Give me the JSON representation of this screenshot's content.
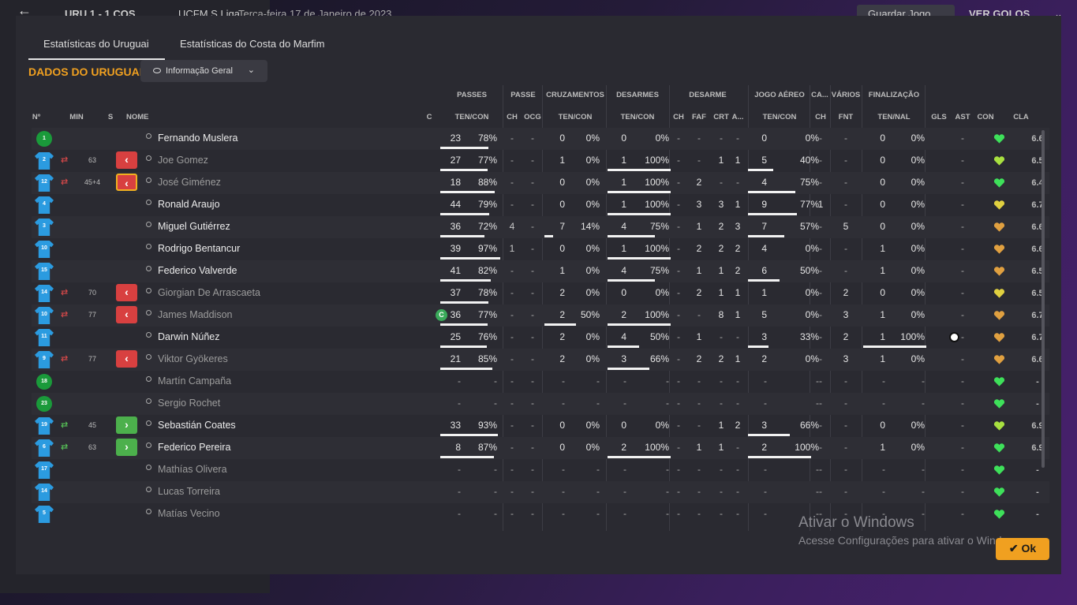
{
  "topbar": {
    "score": "URU 1 - 1 COS",
    "competition": "UCFM S.Liga",
    "date": "Terça-feira 17 de Janeiro de 2023",
    "save_label": "Guardar Jogo",
    "goals_label": "VER GOLOS"
  },
  "tabs": [
    "Estatísticas do Uruguai",
    "Estatísticas do Costa do Marfim"
  ],
  "section_title": "DADOS DO URUGUAI",
  "dropdown_label": "Informação Geral",
  "group_headers": [
    "PASSES",
    "PASSE",
    "CRUZAMENTOS",
    "DESARMES",
    "DESARME",
    "JOGO AÉREO",
    "CA...",
    "VÁRIOS",
    "FINALIZAÇÃO"
  ],
  "columns": [
    "Nº",
    "MIN",
    "S",
    "NOME",
    "C",
    "TEN/CON",
    "CH",
    "OCG",
    "TEN/CON",
    "TEN/CON",
    "CH",
    "FAF",
    "CRT",
    "A...",
    "TEN/CON",
    "CH",
    "FNT",
    "TEN/NAL",
    "GLS",
    "AST",
    "CON",
    "CLA"
  ],
  "heart_colors": {
    "green": "#3ee05a",
    "lime": "#a8e040",
    "yellow": "#e0d040",
    "orange": "#e0a040"
  },
  "players": [
    {
      "num": "1",
      "gk": true,
      "min": "",
      "sub": "",
      "s": "",
      "name": "Fernando Muslera",
      "dim": false,
      "cap": false,
      "pass": [
        "23",
        "78%"
      ],
      "pbar": 0.78,
      "ch": "-",
      "ocg": "-",
      "cross": [
        "0",
        "0%"
      ],
      "cbar": 0,
      "tck": [
        "0",
        "0%"
      ],
      "tbar": 0,
      "dch": "-",
      "faf": "-",
      "crt": "-",
      "a": "-",
      "air": [
        "0",
        "0%"
      ],
      "abar": 0,
      "ca": "-",
      "fnt": "-",
      "shot": [
        "0",
        "0%"
      ],
      "sbar": 0,
      "gls": "",
      "ast": "-",
      "heart": "green",
      "cla": "6.6"
    },
    {
      "num": "2",
      "gk": false,
      "min": "63",
      "sub": "out",
      "s": "red",
      "name": "Joe Gomez",
      "dim": true,
      "cap": false,
      "pass": [
        "27",
        "77%"
      ],
      "pbar": 0.77,
      "ch": "-",
      "ocg": "-",
      "cross": [
        "1",
        "0%"
      ],
      "cbar": 0,
      "tck": [
        "1",
        "100%"
      ],
      "tbar": 1,
      "dch": "-",
      "faf": "-",
      "crt": "1",
      "a": "1",
      "air": [
        "5",
        "40%"
      ],
      "abar": 0.4,
      "ca": "-",
      "fnt": "-",
      "shot": [
        "0",
        "0%"
      ],
      "sbar": 0,
      "gls": "",
      "ast": "-",
      "heart": "lime",
      "cla": "6.5"
    },
    {
      "num": "12",
      "gk": false,
      "min": "45+4",
      "sub": "out",
      "s": "redsel",
      "name": "José Giménez",
      "dim": true,
      "cap": false,
      "pass": [
        "18",
        "88%"
      ],
      "pbar": 0.88,
      "ch": "-",
      "ocg": "-",
      "cross": [
        "0",
        "0%"
      ],
      "cbar": 0,
      "tck": [
        "1",
        "100%"
      ],
      "tbar": 1,
      "dch": "-",
      "faf": "2",
      "crt": "-",
      "a": "-",
      "air": [
        "4",
        "75%"
      ],
      "abar": 0.75,
      "ca": "-",
      "fnt": "-",
      "shot": [
        "0",
        "0%"
      ],
      "sbar": 0,
      "gls": "",
      "ast": "-",
      "heart": "green",
      "cla": "6.4"
    },
    {
      "num": "4",
      "gk": false,
      "min": "",
      "sub": "",
      "s": "",
      "name": "Ronald Araujo",
      "dim": false,
      "cap": false,
      "pass": [
        "44",
        "79%"
      ],
      "pbar": 0.79,
      "ch": "-",
      "ocg": "-",
      "cross": [
        "0",
        "0%"
      ],
      "cbar": 0,
      "tck": [
        "1",
        "100%"
      ],
      "tbar": 1,
      "dch": "-",
      "faf": "3",
      "crt": "3",
      "a": "1",
      "air": [
        "9",
        "77%"
      ],
      "abar": 0.77,
      "ca": "1",
      "fnt": "-",
      "shot": [
        "0",
        "0%"
      ],
      "sbar": 0,
      "gls": "",
      "ast": "-",
      "heart": "yellow",
      "cla": "6.7"
    },
    {
      "num": "3",
      "gk": false,
      "min": "",
      "sub": "",
      "s": "",
      "name": "Miguel Gutiérrez",
      "dim": false,
      "cap": false,
      "pass": [
        "36",
        "72%"
      ],
      "pbar": 0.72,
      "ch": "4",
      "ocg": "-",
      "cross": [
        "7",
        "14%"
      ],
      "cbar": 0.14,
      "tck": [
        "4",
        "75%"
      ],
      "tbar": 0.75,
      "dch": "-",
      "faf": "1",
      "crt": "2",
      "a": "3",
      "air": [
        "7",
        "57%"
      ],
      "abar": 0.57,
      "ca": "-",
      "fnt": "5",
      "shot": [
        "0",
        "0%"
      ],
      "sbar": 0,
      "gls": "",
      "ast": "-",
      "heart": "orange",
      "cla": "6.6"
    },
    {
      "num": "10",
      "gk": false,
      "min": "",
      "sub": "",
      "s": "",
      "name": "Rodrigo Bentancur",
      "dim": false,
      "cap": false,
      "pass": [
        "39",
        "97%"
      ],
      "pbar": 0.97,
      "ch": "1",
      "ocg": "-",
      "cross": [
        "0",
        "0%"
      ],
      "cbar": 0,
      "tck": [
        "1",
        "100%"
      ],
      "tbar": 1,
      "dch": "-",
      "faf": "2",
      "crt": "2",
      "a": "2",
      "air": [
        "4",
        "0%"
      ],
      "abar": 0,
      "ca": "-",
      "fnt": "-",
      "shot": [
        "1",
        "0%"
      ],
      "sbar": 0,
      "gls": "",
      "ast": "-",
      "heart": "orange",
      "cla": "6.6"
    },
    {
      "num": "15",
      "gk": false,
      "min": "",
      "sub": "",
      "s": "",
      "name": "Federico Valverde",
      "dim": false,
      "cap": false,
      "pass": [
        "41",
        "82%"
      ],
      "pbar": 0.82,
      "ch": "-",
      "ocg": "-",
      "cross": [
        "1",
        "0%"
      ],
      "cbar": 0,
      "tck": [
        "4",
        "75%"
      ],
      "tbar": 0.75,
      "dch": "-",
      "faf": "1",
      "crt": "1",
      "a": "2",
      "air": [
        "6",
        "50%"
      ],
      "abar": 0.5,
      "ca": "-",
      "fnt": "-",
      "shot": [
        "1",
        "0%"
      ],
      "sbar": 0,
      "gls": "",
      "ast": "-",
      "heart": "orange",
      "cla": "6.5"
    },
    {
      "num": "14",
      "gk": false,
      "min": "70",
      "sub": "out",
      "s": "red",
      "name": "Giorgian De Arrascaeta",
      "dim": true,
      "cap": false,
      "pass": [
        "37",
        "78%"
      ],
      "pbar": 0.78,
      "ch": "-",
      "ocg": "-",
      "cross": [
        "2",
        "0%"
      ],
      "cbar": 0,
      "tck": [
        "0",
        "0%"
      ],
      "tbar": 0,
      "dch": "-",
      "faf": "2",
      "crt": "1",
      "a": "1",
      "air": [
        "1",
        "0%"
      ],
      "abar": 0,
      "ca": "-",
      "fnt": "2",
      "shot": [
        "0",
        "0%"
      ],
      "sbar": 0,
      "gls": "",
      "ast": "-",
      "heart": "yellow",
      "cla": "6.5"
    },
    {
      "num": "10",
      "gk": false,
      "min": "77",
      "sub": "out",
      "s": "red",
      "name": "James Maddison",
      "dim": true,
      "cap": true,
      "cap_label": "C",
      "pass": [
        "36",
        "77%"
      ],
      "pbar": 0.77,
      "ch": "-",
      "ocg": "-",
      "cross": [
        "2",
        "50%"
      ],
      "cbar": 0.5,
      "tck": [
        "2",
        "100%"
      ],
      "tbar": 1,
      "dch": "-",
      "faf": "-",
      "crt": "8",
      "a": "1",
      "air": [
        "5",
        "0%"
      ],
      "abar": 0,
      "ca": "-",
      "fnt": "3",
      "shot": [
        "1",
        "0%"
      ],
      "sbar": 0,
      "gls": "",
      "ast": "-",
      "heart": "orange",
      "cla": "6.7"
    },
    {
      "num": "11",
      "gk": false,
      "min": "",
      "sub": "",
      "s": "",
      "name": "Darwin Núñez",
      "dim": false,
      "cap": false,
      "pass": [
        "25",
        "76%"
      ],
      "pbar": 0.76,
      "ch": "-",
      "ocg": "-",
      "cross": [
        "2",
        "0%"
      ],
      "cbar": 0,
      "tck": [
        "4",
        "50%"
      ],
      "tbar": 0.5,
      "dch": "-",
      "faf": "1",
      "crt": "-",
      "a": "-",
      "air": [
        "3",
        "33%"
      ],
      "abar": 0.33,
      "ca": "-",
      "fnt": "2",
      "shot": [
        "1",
        "100%"
      ],
      "sbar": 1,
      "gls": "ball",
      "ast": "-",
      "heart": "orange",
      "cla": "6.7"
    },
    {
      "num": "9",
      "gk": false,
      "min": "77",
      "sub": "out",
      "s": "red",
      "name": "Viktor Gyökeres",
      "dim": true,
      "cap": false,
      "pass": [
        "21",
        "85%"
      ],
      "pbar": 0.85,
      "ch": "-",
      "ocg": "-",
      "cross": [
        "2",
        "0%"
      ],
      "cbar": 0,
      "tck": [
        "3",
        "66%"
      ],
      "tbar": 0.66,
      "dch": "-",
      "faf": "2",
      "crt": "2",
      "a": "1",
      "air": [
        "2",
        "0%"
      ],
      "abar": 0,
      "ca": "-",
      "fnt": "3",
      "shot": [
        "1",
        "0%"
      ],
      "sbar": 0,
      "gls": "",
      "ast": "-",
      "heart": "orange",
      "cla": "6.6"
    },
    {
      "num": "18",
      "gk": true,
      "min": "",
      "sub": "",
      "s": "",
      "name": "Martín Campaña",
      "dim": true,
      "cap": false,
      "pass": [
        "-",
        "-"
      ],
      "pbar": 0,
      "ch": "-",
      "ocg": "-",
      "cross": [
        "-",
        "-"
      ],
      "cbar": 0,
      "tck": [
        "-",
        "-"
      ],
      "tbar": 0,
      "dch": "-",
      "faf": "-",
      "crt": "-",
      "a": "-",
      "air": [
        "-",
        "-"
      ],
      "abar": 0,
      "ca": "-",
      "fnt": "-",
      "shot": [
        "-",
        "-"
      ],
      "sbar": 0,
      "gls": "",
      "ast": "-",
      "heart": "green",
      "cla": "-"
    },
    {
      "num": "23",
      "gk": true,
      "min": "",
      "sub": "",
      "s": "",
      "name": "Sergio Rochet",
      "dim": true,
      "cap": false,
      "pass": [
        "-",
        "-"
      ],
      "pbar": 0,
      "ch": "-",
      "ocg": "-",
      "cross": [
        "-",
        "-"
      ],
      "cbar": 0,
      "tck": [
        "-",
        "-"
      ],
      "tbar": 0,
      "dch": "-",
      "faf": "-",
      "crt": "-",
      "a": "-",
      "air": [
        "-",
        "-"
      ],
      "abar": 0,
      "ca": "-",
      "fnt": "-",
      "shot": [
        "-",
        "-"
      ],
      "sbar": 0,
      "gls": "",
      "ast": "-",
      "heart": "green",
      "cla": "-"
    },
    {
      "num": "19",
      "gk": false,
      "min": "45",
      "sub": "in",
      "s": "grn",
      "name": "Sebastián Coates",
      "dim": false,
      "cap": false,
      "pass": [
        "33",
        "93%"
      ],
      "pbar": 0.93,
      "ch": "-",
      "ocg": "-",
      "cross": [
        "0",
        "0%"
      ],
      "cbar": 0,
      "tck": [
        "0",
        "0%"
      ],
      "tbar": 0,
      "dch": "-",
      "faf": "-",
      "crt": "1",
      "a": "2",
      "air": [
        "3",
        "66%"
      ],
      "abar": 0.66,
      "ca": "-",
      "fnt": "-",
      "shot": [
        "0",
        "0%"
      ],
      "sbar": 0,
      "gls": "",
      "ast": "-",
      "heart": "lime",
      "cla": "6.9"
    },
    {
      "num": "6",
      "gk": false,
      "min": "63",
      "sub": "in",
      "s": "grn",
      "name": "Federico Pereira",
      "dim": false,
      "cap": false,
      "pass": [
        "8",
        "87%"
      ],
      "pbar": 0.87,
      "ch": "-",
      "ocg": "-",
      "cross": [
        "0",
        "0%"
      ],
      "cbar": 0,
      "tck": [
        "2",
        "100%"
      ],
      "tbar": 1,
      "dch": "-",
      "faf": "1",
      "crt": "1",
      "a": "-",
      "air": [
        "2",
        "100%"
      ],
      "abar": 1,
      "ca": "-",
      "fnt": "-",
      "shot": [
        "1",
        "0%"
      ],
      "sbar": 0,
      "gls": "",
      "ast": "-",
      "heart": "green",
      "cla": "6.9"
    },
    {
      "num": "17",
      "gk": false,
      "min": "",
      "sub": "",
      "s": "",
      "name": "Mathías Olivera",
      "dim": true,
      "cap": false,
      "pass": [
        "-",
        "-"
      ],
      "pbar": 0,
      "ch": "-",
      "ocg": "-",
      "cross": [
        "-",
        "-"
      ],
      "cbar": 0,
      "tck": [
        "-",
        "-"
      ],
      "tbar": 0,
      "dch": "-",
      "faf": "-",
      "crt": "-",
      "a": "-",
      "air": [
        "-",
        "-"
      ],
      "abar": 0,
      "ca": "-",
      "fnt": "-",
      "shot": [
        "-",
        "-"
      ],
      "sbar": 0,
      "gls": "",
      "ast": "-",
      "heart": "green",
      "cla": "-"
    },
    {
      "num": "14",
      "gk": false,
      "min": "",
      "sub": "",
      "s": "",
      "name": "Lucas Torreira",
      "dim": true,
      "cap": false,
      "pass": [
        "-",
        "-"
      ],
      "pbar": 0,
      "ch": "-",
      "ocg": "-",
      "cross": [
        "-",
        "-"
      ],
      "cbar": 0,
      "tck": [
        "-",
        "-"
      ],
      "tbar": 0,
      "dch": "-",
      "faf": "-",
      "crt": "-",
      "a": "-",
      "air": [
        "-",
        "-"
      ],
      "abar": 0,
      "ca": "-",
      "fnt": "-",
      "shot": [
        "-",
        "-"
      ],
      "sbar": 0,
      "gls": "",
      "ast": "-",
      "heart": "green",
      "cla": "-"
    },
    {
      "num": "5",
      "gk": false,
      "min": "",
      "sub": "",
      "s": "",
      "name": "Matías Vecino",
      "dim": true,
      "cap": false,
      "pass": [
        "-",
        "-"
      ],
      "pbar": 0,
      "ch": "-",
      "ocg": "-",
      "cross": [
        "-",
        "-"
      ],
      "cbar": 0,
      "tck": [
        "-",
        "-"
      ],
      "tbar": 0,
      "dch": "-",
      "faf": "-",
      "crt": "-",
      "a": "-",
      "air": [
        "-",
        "-"
      ],
      "abar": 0,
      "ca": "-",
      "fnt": "-",
      "shot": [
        "-",
        "-"
      ],
      "sbar": 0,
      "gls": "",
      "ast": "-",
      "heart": "green",
      "cla": "-"
    }
  ],
  "watermark": {
    "line1": "Ativar o Windows",
    "line2": "Acesse Configurações para ativar o Windows."
  },
  "ok_label": "Ok"
}
